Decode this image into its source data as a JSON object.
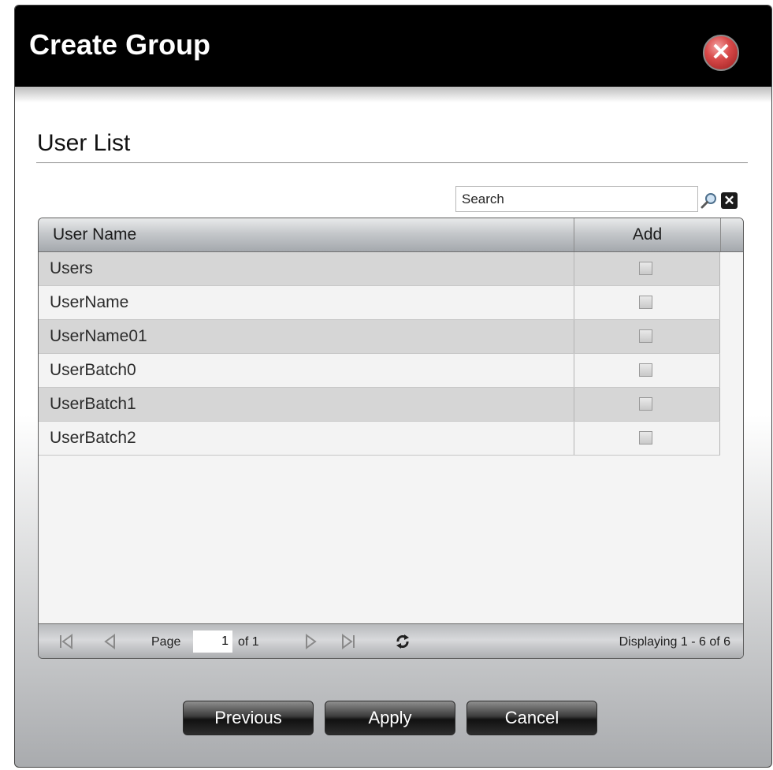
{
  "dialog": {
    "title": "Create Group",
    "close_icon": "close-icon"
  },
  "section": {
    "title": "User List"
  },
  "search": {
    "value": "Search",
    "search_icon": "magnifier-icon",
    "clear_icon": "clear-x-icon"
  },
  "table": {
    "columns": [
      "User Name",
      "Add"
    ],
    "rows": [
      {
        "name": "Users",
        "add": false
      },
      {
        "name": "UserName",
        "add": false
      },
      {
        "name": "UserName01",
        "add": false
      },
      {
        "name": "UserBatch0",
        "add": false
      },
      {
        "name": "UserBatch1",
        "add": false
      },
      {
        "name": "UserBatch2",
        "add": false
      }
    ]
  },
  "pager": {
    "page_label": "Page",
    "page_value": "1",
    "of_label": "of 1",
    "display_text": "Displaying 1 - 6 of 6",
    "icons": [
      "first-page-icon",
      "prev-page-icon",
      "next-page-icon",
      "last-page-icon",
      "refresh-icon"
    ]
  },
  "buttons": {
    "previous": "Previous",
    "apply": "Apply",
    "cancel": "Cancel"
  },
  "colors": {
    "title_bar": "#000000",
    "close_button": "#d94b4b"
  }
}
